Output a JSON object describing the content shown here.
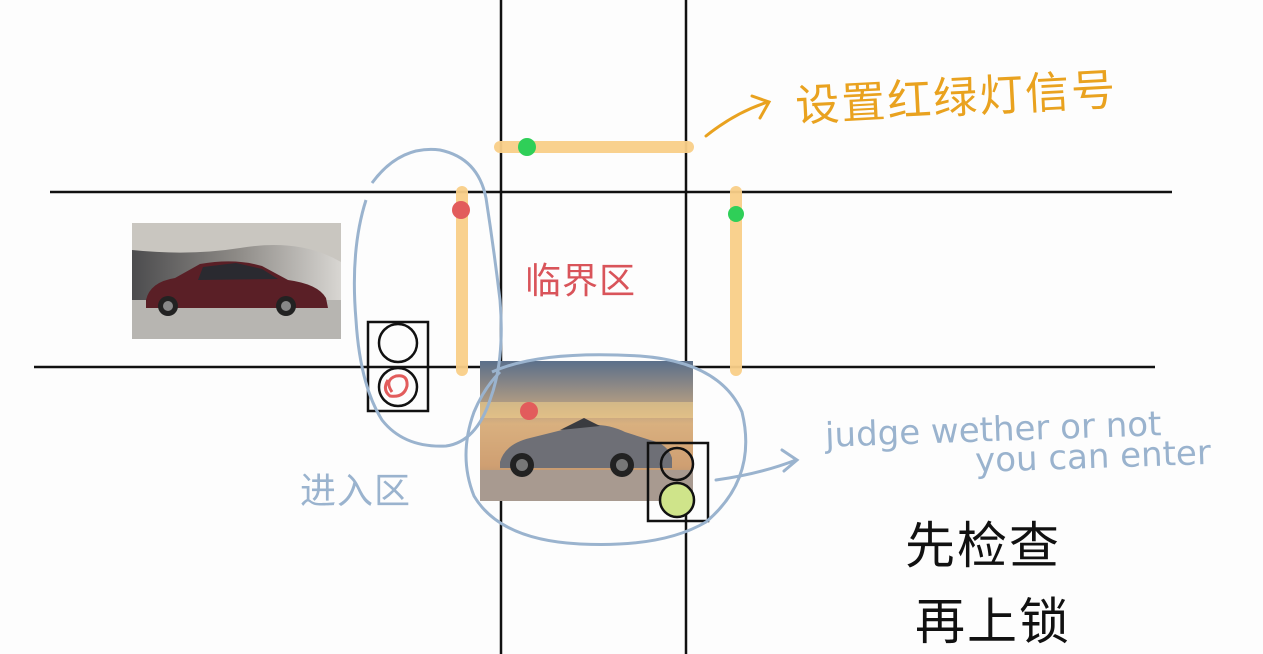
{
  "colors": {
    "road_line": "#111111",
    "zone_bar": "#f9cf89",
    "green_light": "#2fcf58",
    "red_light": "#e25c5c",
    "ink_blue": "#9ab3ce",
    "ink_orange": "#e9a21f",
    "ink_red": "#d9545a"
  },
  "annotations": {
    "yellow_light_signal": "设置红绿灯信号",
    "critical_zone": "临界区",
    "entry_zone": "进入区",
    "judge_line1": "judge wether or not",
    "judge_line2": "you can enter",
    "check_line1": "先检查",
    "check_line2": "再上锁"
  },
  "images": [
    {
      "name": "sedan-photo",
      "subject": "dark red luxury sedan"
    },
    {
      "name": "convertible-photo",
      "subject": "grey convertible sports car"
    }
  ],
  "icons": [
    "traffic-light-icon",
    "arrow-right-icon"
  ]
}
